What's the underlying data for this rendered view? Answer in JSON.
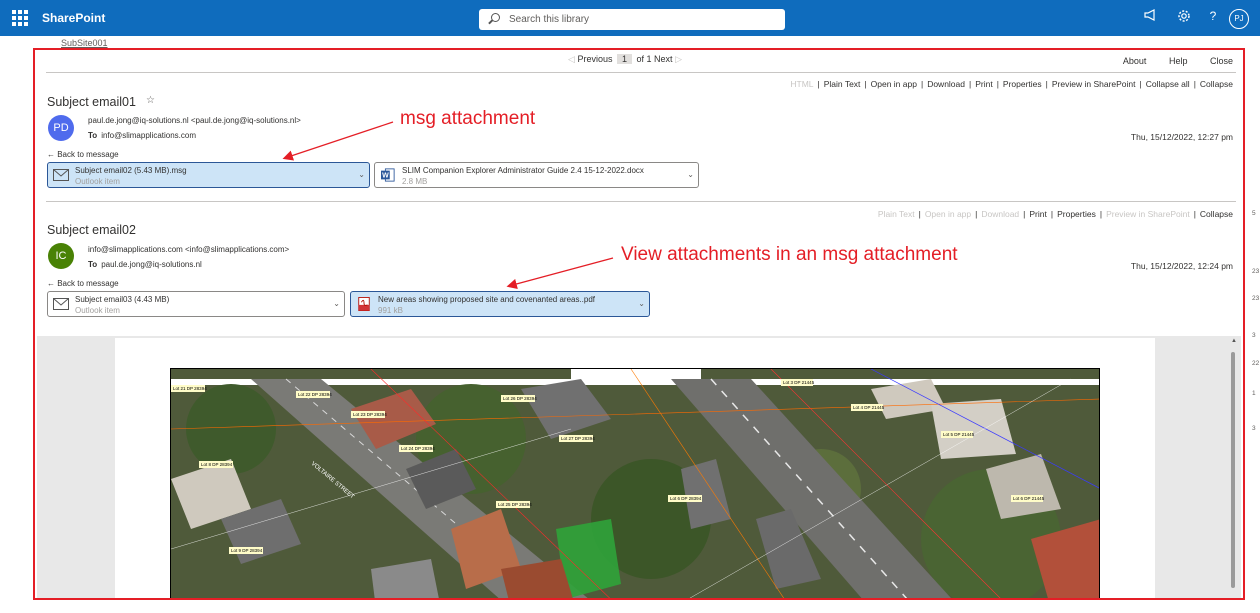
{
  "suite": {
    "app_name": "SharePoint",
    "search_placeholder": "Search this library",
    "user_initials": "PJ"
  },
  "breadcrumb": {
    "site": "SubSite001"
  },
  "pager": {
    "previous": "Previous",
    "page": "1",
    "of_text": "of 1",
    "next": "Next"
  },
  "top_links": {
    "about": "About",
    "help": "Help",
    "close": "Close"
  },
  "email1": {
    "actions": {
      "html": "HTML",
      "plain_text": "Plain Text",
      "open_in_app": "Open in app",
      "download": "Download",
      "print": "Print",
      "properties": "Properties",
      "preview": "Preview in SharePoint",
      "collapse_all": "Collapse all",
      "collapse": "Collapse"
    },
    "subject": "Subject email01",
    "star": "☆",
    "avatar_initials": "PD",
    "from": "paul.de.jong@iq-solutions.nl <paul.de.jong@iq-solutions.nl>",
    "to_label": "To",
    "to": "info@slimapplications.com",
    "date": "Thu, 15/12/2022, 12:27 pm",
    "back": "← Back to message",
    "attachments": [
      {
        "name": "Subject email02 (5.43 MB).msg",
        "sub": "Outlook item",
        "icon": "envelope-icon"
      },
      {
        "name": "SLIM Companion Explorer Administrator Guide 2.4 15-12-2022.docx",
        "sub": "2.8 MB",
        "icon": "word-icon"
      }
    ]
  },
  "email2": {
    "actions": {
      "plain_text": "Plain Text",
      "open_in_app": "Open in app",
      "download": "Download",
      "print": "Print",
      "properties": "Properties",
      "preview": "Preview in SharePoint",
      "collapse": "Collapse"
    },
    "subject": "Subject email02",
    "avatar_initials": "IC",
    "from": "info@slimapplications.com <info@slimapplications.com>",
    "to_label": "To",
    "to": "paul.de.jong@iq-solutions.nl",
    "date": "Thu, 15/12/2022, 12:24 pm",
    "back": "← Back to message",
    "attachments": [
      {
        "name": "Subject email03 (4.43 MB)",
        "sub": "Outlook item",
        "icon": "envelope-icon"
      },
      {
        "name": "New areas showing proposed site and covenanted areas..pdf",
        "sub": "991 kB",
        "icon": "pdf-icon"
      }
    ]
  },
  "annotations": {
    "msg_attachment": "msg attachment",
    "view_attachments": "View attachments in an msg attachment"
  },
  "map_labels": {
    "l1": "Lot 22 DP 28394",
    "l2": "Lot 23 DP 28394",
    "l3": "Lot 24 DP 28394",
    "l4": "Lot 26 DP 28394",
    "l5": "Lot 27 DP 28394",
    "l6": "Lot 8 DP 28394",
    "l7": "Lot 9 DP 28394",
    "l8": "Lot 3 DP 21445",
    "l9": "Lot 4 DP 21445",
    "l10": "Lot 5 DP 21445",
    "l11": "Lot 6 DP 21445",
    "l12": "Lot 25 DP 28394",
    "l13": "Lot 6 DP 28394",
    "l14": "Lot 21 DP 28394",
    "street": "VOLTAIRE STREET"
  },
  "right_edge_numbers": [
    "5",
    "23",
    "23",
    "3",
    "22",
    "1",
    "3"
  ],
  "colors": {
    "brand": "#0f6cbd",
    "annotation": "#e41e26",
    "selected_attachment": "#cde4f7"
  }
}
